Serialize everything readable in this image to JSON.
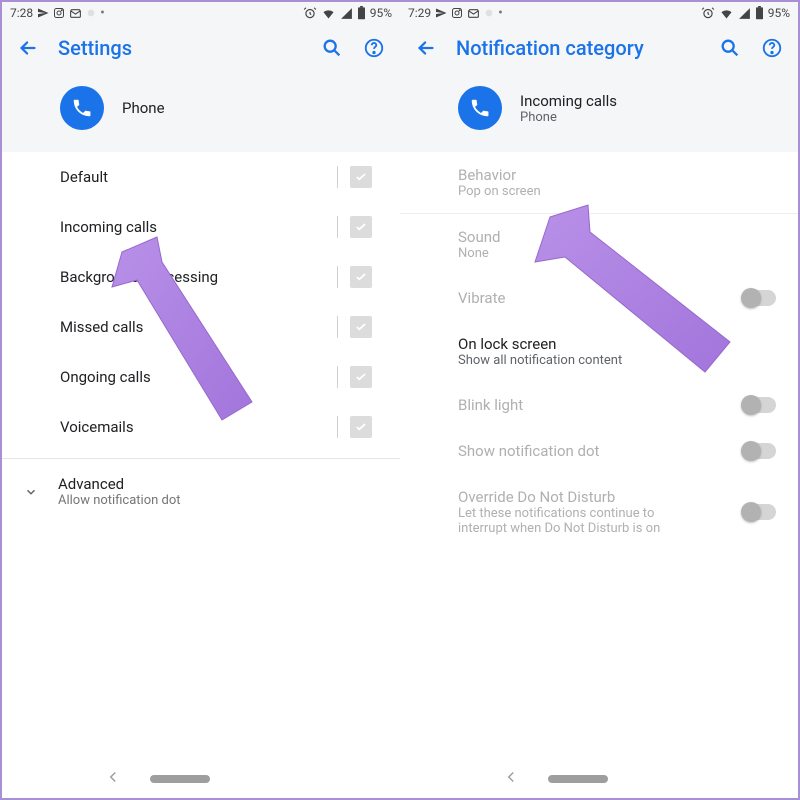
{
  "left": {
    "status": {
      "time": "7:28",
      "battery": "95%"
    },
    "title": "Settings",
    "app": {
      "name": "Phone"
    },
    "categories": [
      "Default",
      "Incoming calls",
      "Background Processing",
      "Missed calls",
      "Ongoing calls",
      "Voicemails"
    ],
    "advanced": {
      "title": "Advanced",
      "sub": "Allow notification dot"
    }
  },
  "right": {
    "status": {
      "time": "7:29",
      "battery": "95%"
    },
    "title": "Notification category",
    "app": {
      "name": "Incoming calls",
      "sub": "Phone"
    },
    "rows": {
      "behavior": {
        "title": "Behavior",
        "sub": "Pop on screen"
      },
      "sound": {
        "title": "Sound",
        "sub": "None"
      },
      "vibrate": {
        "title": "Vibrate"
      },
      "lock": {
        "title": "On lock screen",
        "sub": "Show all notification content"
      },
      "blink": {
        "title": "Blink light"
      },
      "dot": {
        "title": "Show notification dot"
      },
      "override": {
        "title": "Override Do Not Disturb",
        "sub": "Let these notifications continue to interrupt when Do Not Disturb is on"
      }
    }
  }
}
